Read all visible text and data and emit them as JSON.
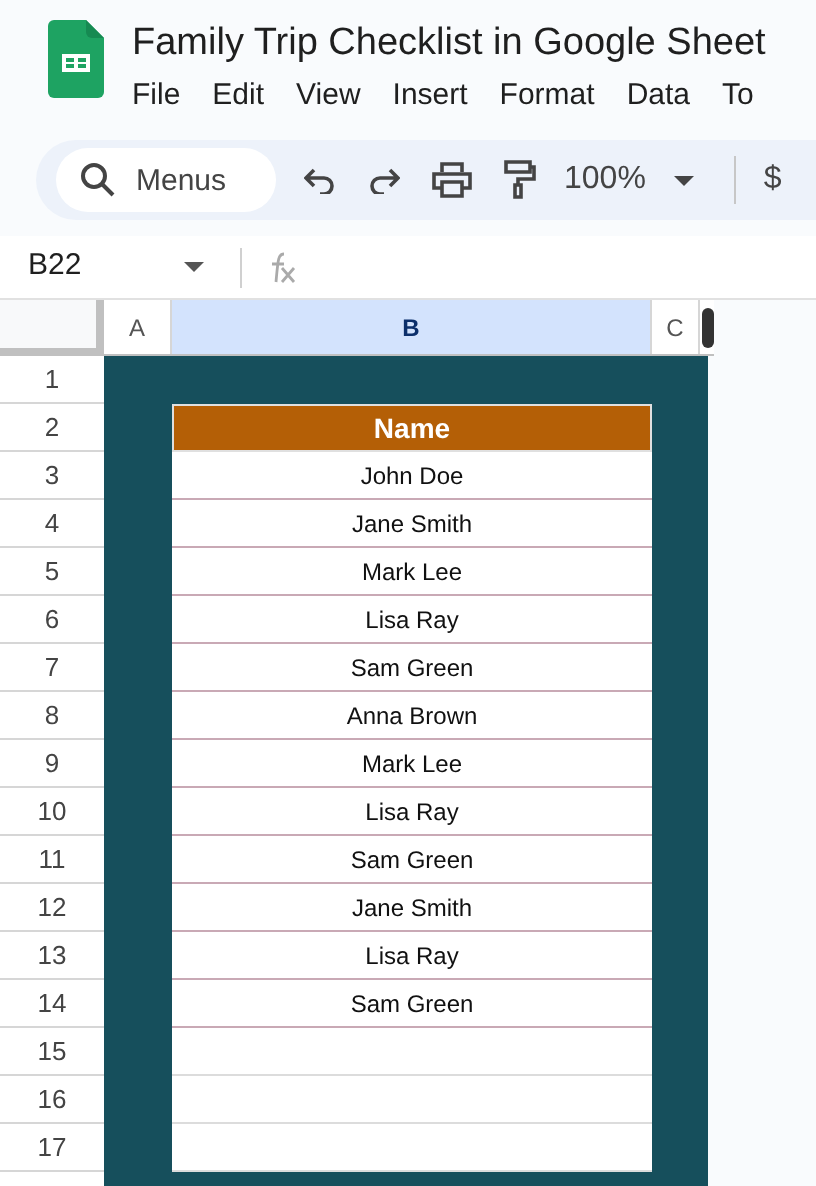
{
  "document": {
    "title": "Family Trip Checklist in Google Sheet"
  },
  "menu": [
    "File",
    "Edit",
    "View",
    "Insert",
    "Format",
    "Data",
    "To"
  ],
  "toolbar": {
    "search": {
      "placeholder": "Menus"
    },
    "zoom": "100%",
    "currency": "$"
  },
  "formula_bar": {
    "cell_ref": "B22"
  },
  "columns": [
    {
      "label": "A",
      "selected": false
    },
    {
      "label": "B",
      "selected": true
    },
    {
      "label": "C",
      "selected": false
    }
  ],
  "row_numbers": [
    "1",
    "2",
    "3",
    "4",
    "5",
    "6",
    "7",
    "8",
    "9",
    "10",
    "11",
    "12",
    "13",
    "14",
    "15",
    "16",
    "17"
  ],
  "table": {
    "header": "Name",
    "rows": [
      "John Doe",
      "Jane Smith",
      "Mark Lee",
      "Lisa Ray",
      "Sam Green",
      "Anna Brown",
      "Mark Lee",
      "Lisa Ray",
      "Sam Green",
      "Jane Smith",
      "Lisa Ray",
      "Sam Green",
      "",
      "",
      ""
    ]
  }
}
